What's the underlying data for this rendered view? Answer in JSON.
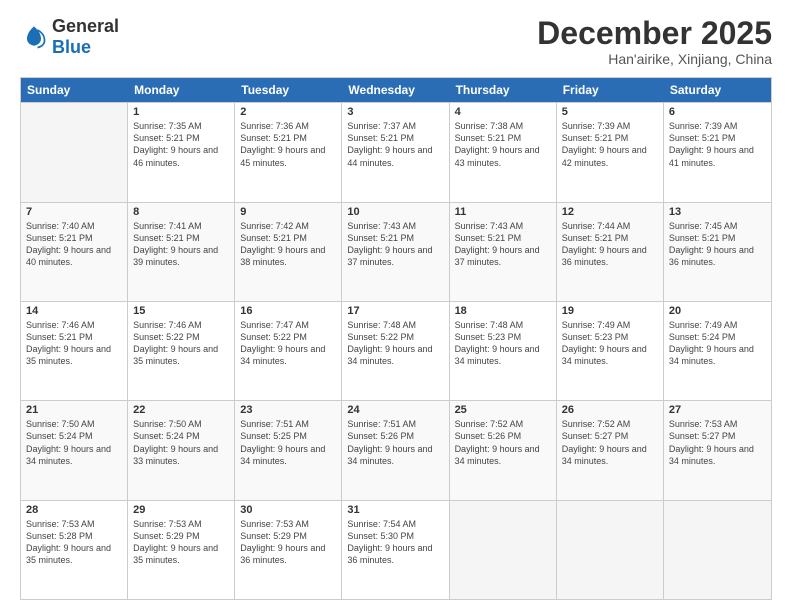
{
  "header": {
    "logo": {
      "general": "General",
      "blue": "Blue"
    },
    "title": "December 2025",
    "location": "Han'airike, Xinjiang, China"
  },
  "weekdays": [
    "Sunday",
    "Monday",
    "Tuesday",
    "Wednesday",
    "Thursday",
    "Friday",
    "Saturday"
  ],
  "weeks": [
    [
      {
        "day": "",
        "empty": true
      },
      {
        "day": "1",
        "sunrise": "7:35 AM",
        "sunset": "5:21 PM",
        "daylight": "9 hours and 46 minutes."
      },
      {
        "day": "2",
        "sunrise": "7:36 AM",
        "sunset": "5:21 PM",
        "daylight": "9 hours and 45 minutes."
      },
      {
        "day": "3",
        "sunrise": "7:37 AM",
        "sunset": "5:21 PM",
        "daylight": "9 hours and 44 minutes."
      },
      {
        "day": "4",
        "sunrise": "7:38 AM",
        "sunset": "5:21 PM",
        "daylight": "9 hours and 43 minutes."
      },
      {
        "day": "5",
        "sunrise": "7:39 AM",
        "sunset": "5:21 PM",
        "daylight": "9 hours and 42 minutes."
      },
      {
        "day": "6",
        "sunrise": "7:39 AM",
        "sunset": "5:21 PM",
        "daylight": "9 hours and 41 minutes."
      }
    ],
    [
      {
        "day": "7",
        "sunrise": "7:40 AM",
        "sunset": "5:21 PM",
        "daylight": "9 hours and 40 minutes."
      },
      {
        "day": "8",
        "sunrise": "7:41 AM",
        "sunset": "5:21 PM",
        "daylight": "9 hours and 39 minutes."
      },
      {
        "day": "9",
        "sunrise": "7:42 AM",
        "sunset": "5:21 PM",
        "daylight": "9 hours and 38 minutes."
      },
      {
        "day": "10",
        "sunrise": "7:43 AM",
        "sunset": "5:21 PM",
        "daylight": "9 hours and 37 minutes."
      },
      {
        "day": "11",
        "sunrise": "7:43 AM",
        "sunset": "5:21 PM",
        "daylight": "9 hours and 37 minutes."
      },
      {
        "day": "12",
        "sunrise": "7:44 AM",
        "sunset": "5:21 PM",
        "daylight": "9 hours and 36 minutes."
      },
      {
        "day": "13",
        "sunrise": "7:45 AM",
        "sunset": "5:21 PM",
        "daylight": "9 hours and 36 minutes."
      }
    ],
    [
      {
        "day": "14",
        "sunrise": "7:46 AM",
        "sunset": "5:21 PM",
        "daylight": "9 hours and 35 minutes."
      },
      {
        "day": "15",
        "sunrise": "7:46 AM",
        "sunset": "5:22 PM",
        "daylight": "9 hours and 35 minutes."
      },
      {
        "day": "16",
        "sunrise": "7:47 AM",
        "sunset": "5:22 PM",
        "daylight": "9 hours and 34 minutes."
      },
      {
        "day": "17",
        "sunrise": "7:48 AM",
        "sunset": "5:22 PM",
        "daylight": "9 hours and 34 minutes."
      },
      {
        "day": "18",
        "sunrise": "7:48 AM",
        "sunset": "5:23 PM",
        "daylight": "9 hours and 34 minutes."
      },
      {
        "day": "19",
        "sunrise": "7:49 AM",
        "sunset": "5:23 PM",
        "daylight": "9 hours and 34 minutes."
      },
      {
        "day": "20",
        "sunrise": "7:49 AM",
        "sunset": "5:24 PM",
        "daylight": "9 hours and 34 minutes."
      }
    ],
    [
      {
        "day": "21",
        "sunrise": "7:50 AM",
        "sunset": "5:24 PM",
        "daylight": "9 hours and 34 minutes."
      },
      {
        "day": "22",
        "sunrise": "7:50 AM",
        "sunset": "5:24 PM",
        "daylight": "9 hours and 33 minutes."
      },
      {
        "day": "23",
        "sunrise": "7:51 AM",
        "sunset": "5:25 PM",
        "daylight": "9 hours and 34 minutes."
      },
      {
        "day": "24",
        "sunrise": "7:51 AM",
        "sunset": "5:26 PM",
        "daylight": "9 hours and 34 minutes."
      },
      {
        "day": "25",
        "sunrise": "7:52 AM",
        "sunset": "5:26 PM",
        "daylight": "9 hours and 34 minutes."
      },
      {
        "day": "26",
        "sunrise": "7:52 AM",
        "sunset": "5:27 PM",
        "daylight": "9 hours and 34 minutes."
      },
      {
        "day": "27",
        "sunrise": "7:53 AM",
        "sunset": "5:27 PM",
        "daylight": "9 hours and 34 minutes."
      }
    ],
    [
      {
        "day": "28",
        "sunrise": "7:53 AM",
        "sunset": "5:28 PM",
        "daylight": "9 hours and 35 minutes."
      },
      {
        "day": "29",
        "sunrise": "7:53 AM",
        "sunset": "5:29 PM",
        "daylight": "9 hours and 35 minutes."
      },
      {
        "day": "30",
        "sunrise": "7:53 AM",
        "sunset": "5:29 PM",
        "daylight": "9 hours and 36 minutes."
      },
      {
        "day": "31",
        "sunrise": "7:54 AM",
        "sunset": "5:30 PM",
        "daylight": "9 hours and 36 minutes."
      },
      {
        "day": "",
        "empty": true
      },
      {
        "day": "",
        "empty": true
      },
      {
        "day": "",
        "empty": true
      }
    ]
  ],
  "labels": {
    "sunrise_prefix": "Sunrise: ",
    "sunset_prefix": "Sunset: ",
    "daylight_prefix": "Daylight: "
  }
}
